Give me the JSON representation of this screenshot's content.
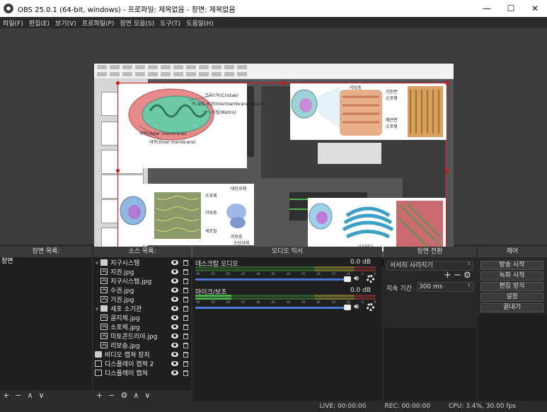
{
  "window": {
    "title": "OBS 25.0.1 (64-bit, windows) - 프로파일: 제목없음 - 장면: 제목없음",
    "min_label": "—",
    "max_label": "☐",
    "close_label": "✕"
  },
  "menu": [
    "파일(F)",
    "편집(E)",
    "보기(V)",
    "프로파일(P)",
    "장면 모음(S)",
    "도구(T)",
    "도움말(H)"
  ],
  "preview": {
    "labels": {
      "cristae": "크리스타(Cristae)",
      "intermembrane": "막 사이 공간(intermembrane space)",
      "matrix": "기질(Matrix)",
      "outer": "외막(outer membrane)",
      "inner": "내막(inner membrane)",
      "ribosome_top": "리보솜",
      "rough_er": "거친면\n소포체",
      "smooth_er": "매끈면\n소포체",
      "vesicle": "소포체",
      "ribosome_mid": "리보솜",
      "cytoplasm": "세포질",
      "ribosome_bottom": "리보솜",
      "golgi": "시스터나",
      "large_subunit": "대단위체",
      "small_subunit": "소단위체"
    }
  },
  "scenes": {
    "header": "장면 목록:",
    "items": [
      "장면"
    ]
  },
  "sources": {
    "header": "소스 목록:",
    "items": [
      {
        "name": "지구시스템",
        "type": "folder",
        "expanded": true,
        "indent": 0
      },
      {
        "name": "지권.jpg",
        "type": "image",
        "indent": 1
      },
      {
        "name": "지구시스템.jpg",
        "type": "image",
        "indent": 1
      },
      {
        "name": "수권.jpg",
        "type": "image",
        "indent": 1
      },
      {
        "name": "기권.jpg",
        "type": "image",
        "indent": 1
      },
      {
        "name": "세포 소기관",
        "type": "folder",
        "expanded": true,
        "indent": 0
      },
      {
        "name": "골지체.jpg",
        "type": "image",
        "indent": 1
      },
      {
        "name": "소포체.jpg",
        "type": "image",
        "indent": 1
      },
      {
        "name": "미토콘드리아.jpg",
        "type": "image",
        "indent": 1
      },
      {
        "name": "리보솜.jpg",
        "type": "image",
        "indent": 1
      },
      {
        "name": "비디오 캡쳐 장치",
        "type": "camera",
        "indent": 0
      },
      {
        "name": "디스플레이 캡쳐 2",
        "type": "display",
        "indent": 0
      },
      {
        "name": "디스플레이 캡쳐",
        "type": "display",
        "indent": 0
      }
    ]
  },
  "mixer": {
    "header": "오디오 믹서",
    "channels": [
      {
        "name": "데스크탑 오디오",
        "db": "0.0 dB",
        "level": 0.0
      },
      {
        "name": "마이크/보조",
        "db": "0.0 dB",
        "level": 0.2
      }
    ],
    "ticks": [
      "-60",
      "-55",
      "-50",
      "-45",
      "-40",
      "-35",
      "-30",
      "-25",
      "-20",
      "-15",
      "-10",
      "-5",
      "0"
    ]
  },
  "transitions": {
    "header": "장면 전환",
    "selected": "서서히 사라지기",
    "duration_label": "지속 기간",
    "duration_value": "300 ms"
  },
  "controls": {
    "header": "제어",
    "buttons": [
      "방송 시작",
      "녹화 시작",
      "편집 방식",
      "설정",
      "끝내기"
    ]
  },
  "status": {
    "live": "LIVE: 00:00:00",
    "rec": "REC: 00:00:00",
    "cpu": "CPU: 3.4%, 30.00 fps"
  },
  "colors": {
    "selection": "#dd1111",
    "volume_slider": "#4a7ad6",
    "meter_green": "#4cb14c"
  }
}
